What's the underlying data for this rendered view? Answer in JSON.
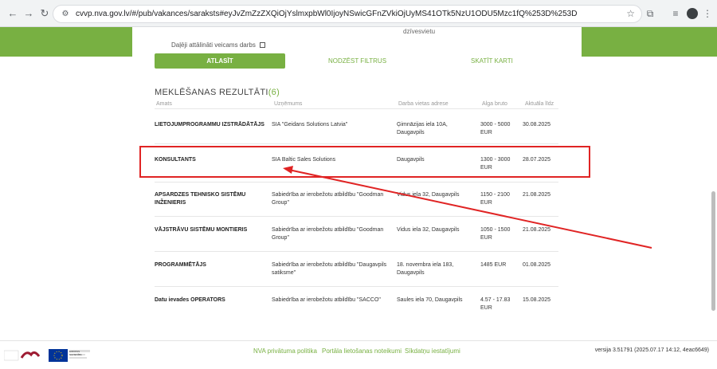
{
  "browser": {
    "url": "cvvp.nva.gov.lv/#/pub/vakances/saraksts#eyJvZmZzZXQiOjYslmxpbWl0IjoyNSwicGFnZVkiOjUyMS41OTk5NzU1ODU5Mzc1fQ%253D%253D",
    "back_icon": "arrow-left",
    "forward_icon": "arrow-right",
    "reload_icon": "reload",
    "star_icon": "star"
  },
  "filters": {
    "dzives_vieta": "dzīvesvietu",
    "remote_label": "Daļēji attālināti veicams darbs",
    "search_button": "ATLASĪT",
    "clear_button": "NODZĒST FILTRUS",
    "map_button": "SKATĪT KARTI"
  },
  "results": {
    "title": "MEKLĒŠANAS REZULTĀTI",
    "count": "(6)",
    "headers": [
      "Amats",
      "Uzņēmums",
      "Darba vietas adrese",
      "Alga bruto",
      "Aktuāla līdz"
    ],
    "rows": [
      {
        "title": "LIETOJUMPROGRAMMU IZSTRĀDĀTĀJS",
        "company": "SIA \"Geidans Solutions Latvia\"",
        "address": "Ģimnāzijas iela 10A, Daugavpils",
        "salary": "3000 - 5000 EUR",
        "date": "30.08.2025"
      },
      {
        "title": "KONSULTANTS",
        "company": "SIA Baltic Sales Solutions",
        "address": "Daugavpils",
        "salary": "1300 - 3000 EUR",
        "date": "28.07.2025"
      },
      {
        "title": "APSARDZES TEHNISKO SISTĒMU INŽENIERIS",
        "company": "Sabiedrība ar ierobežotu atbildību \"Goodman Group\"",
        "address": "Vidus iela 32, Daugavpils",
        "salary": "1150 - 2100 EUR",
        "date": "21.08.2025"
      },
      {
        "title": "VĀJSTRĀVU SISTĒMU MONTIERIS",
        "company": "Sabiedrība ar ierobežotu atbildību \"Goodman Group\"",
        "address": "Vidus iela 32, Daugavpils",
        "salary": "1050 - 1500 EUR",
        "date": "21.08.2025"
      },
      {
        "title": "PROGRAMMĒTĀJS",
        "company": "Sabiedrība ar ierobežotu atbildību \"Daugavpils satiksme\"",
        "address": "18. novembra iela 183, Daugavpils",
        "salary": "1485 EUR",
        "date": "01.08.2025"
      },
      {
        "title": "Datu ievades OPERATORS",
        "company": "Sabiedrība ar ierobežotu atbildību \"SACCO\"",
        "address": "Saules iela 70, Daugavpils",
        "salary": "4.57 - 17.83 EUR",
        "date": "15.08.2025"
      }
    ]
  },
  "footer": {
    "privacy": "NVA privātuma politika",
    "terms": "Portāla lietošanas noteikumi",
    "cookies": "Sīkdatņu iestatījumi",
    "version": "versija 3.51791 (2025.07.17 14:12, 4eac6649)",
    "logo_text": "EIROPAS SAVIENĪBA",
    "brand_color": "#78b042",
    "annotation_color": "#e02424"
  }
}
